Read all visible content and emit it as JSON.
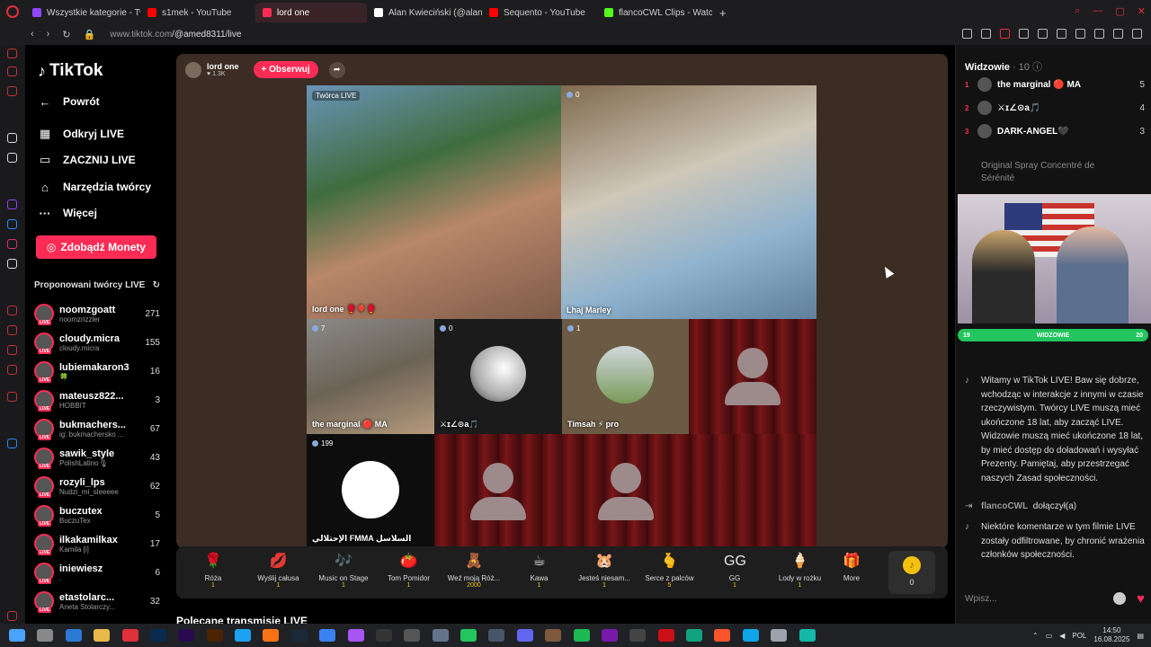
{
  "browser": {
    "tabs": [
      {
        "label": "Wszystkie kategorie - Tw",
        "color": "#9146ff",
        "active": false
      },
      {
        "label": "s1mek - YouTube",
        "color": "#ff0000",
        "active": false
      },
      {
        "label": "lord one",
        "color": "#fe2c55",
        "active": true
      },
      {
        "label": "Alan Kwieciński (@alanik",
        "color": "#ffffff",
        "active": false
      },
      {
        "label": "Sequento - YouTube",
        "color": "#ff0000",
        "active": false
      },
      {
        "label": "flancoCWL Clips - Watch",
        "color": "#53fc18",
        "active": false
      }
    ],
    "new_tab": "+",
    "url_domain": "www.tiktok.com",
    "url_path": "/@amed8311/live"
  },
  "tiktok": {
    "logo": "TikTok",
    "nav": [
      {
        "label": "Powrót",
        "icon": "arrow-left-icon",
        "glyph": "←"
      },
      {
        "label": "Odkryj LIVE",
        "icon": "calendar-icon",
        "glyph": "▦"
      },
      {
        "label": "ZACZNIJ LIVE",
        "icon": "camera-icon",
        "glyph": "▭"
      },
      {
        "label": "Narzędzia twórcy",
        "icon": "house-icon",
        "glyph": "⌂"
      },
      {
        "label": "Więcej",
        "icon": "ellipsis-icon",
        "glyph": "···"
      }
    ],
    "coins_button": "Zdobądź Monety",
    "suggested_title": "Proponowani twórcy LIVE",
    "creators": [
      {
        "name": "noomzgoatt",
        "sub": "noomzrizzler",
        "count": "271"
      },
      {
        "name": "cloudy.micra",
        "sub": "cloudy.micra",
        "count": "155"
      },
      {
        "name": "lubiemakaron3",
        "sub": "🍀",
        "count": "16"
      },
      {
        "name": "mateusz822...",
        "sub": "HOBBIT",
        "count": "3"
      },
      {
        "name": "bukmachers...",
        "sub": "ig: bukmachersko ...",
        "count": "67"
      },
      {
        "name": "sawik_style",
        "sub": "PolishLatino🎙",
        "count": "43"
      },
      {
        "name": "rozyli_lps",
        "sub": "Nudzi_mi_sleeeee",
        "count": "62"
      },
      {
        "name": "buczutex",
        "sub": "BuczuTex",
        "count": "5"
      },
      {
        "name": "ilkakamilkax",
        "sub": "Kamila [i]",
        "count": "17"
      },
      {
        "name": "iniewiesz",
        "sub": ".",
        "count": "6"
      },
      {
        "name": "etastolarc...",
        "sub": "Aneta Stolarczy...",
        "count": "32"
      }
    ]
  },
  "live": {
    "host": {
      "name": "lord one",
      "likes": "♥ 1.3K"
    },
    "follow_label": "+ Obserwuj",
    "cells": [
      {
        "label": "lord one 🥊🎈🥊",
        "tag": "Twórca LIVE"
      },
      {
        "label": "Lhaj Marley",
        "count": "0"
      },
      {
        "label": "the marginal 🔴 MA",
        "count": "7"
      },
      {
        "label": "⚔ɪ∠⊙a🎵",
        "count": "0"
      },
      {
        "label": "Timsah ⚡ pro",
        "count": "1"
      },
      {
        "label": "الإحتلالي FMMA السلاسل",
        "count": "199"
      }
    ],
    "gifts": [
      {
        "name": "Róża",
        "price": "1",
        "glyph": "🌹"
      },
      {
        "name": "Wyślij całusa",
        "price": "1",
        "glyph": "💋"
      },
      {
        "name": "Music on Stage",
        "price": "1",
        "glyph": "🎶"
      },
      {
        "name": "Tom Pomidor",
        "price": "1",
        "glyph": "🍅"
      },
      {
        "name": "Weź moją Róż...",
        "price": "2000",
        "glyph": "🧸"
      },
      {
        "name": "Kawa",
        "price": "1",
        "glyph": "☕"
      },
      {
        "name": "Jesteś niesam...",
        "price": "1",
        "glyph": "🐹"
      },
      {
        "name": "Serce z palców",
        "price": "5",
        "glyph": "🫰"
      },
      {
        "name": "GG",
        "price": "1",
        "glyph": "GG"
      },
      {
        "name": "Lody w rożku",
        "price": "1",
        "glyph": "🍦"
      },
      {
        "name": "More",
        "price": "",
        "glyph": "🎁"
      }
    ],
    "coin_balance": "0",
    "recommended": "Polecane transmisje LIVE"
  },
  "panel": {
    "title": "Widzowie",
    "count": "· 10",
    "top": [
      {
        "rank": "1",
        "name": "the marginal 🔴 MA",
        "score": "5"
      },
      {
        "rank": "2",
        "name": "⚔ɪ∠⊙a🎵",
        "score": "4"
      },
      {
        "rank": "3",
        "name": "DARK-ANGEL🖤",
        "score": "3"
      }
    ],
    "faded_text": "Original Spray Concentré de Sérénité",
    "battle_left": "19",
    "battle_mid": "WIDZOWIE",
    "battle_right": "20",
    "welcome": "Witamy w TikTok LIVE! Baw się dobrze, wchodząc w interakcje z innymi w czasie rzeczywistym. Twórcy LIVE muszą mieć ukończone 18 lat, aby zacząć LIVE. Widzowie muszą mieć ukończone 18 lat, by mieć dostęp do doładowań i wysyłać Prezenty. Pamiętaj, aby przestrzegać naszych Zasad społeczności.",
    "join_user": "flancoCWL",
    "join_text": "dołączył(a)",
    "filter_text": "Niektóre komentarze w tym filmie LIVE zostały odfiltrowane, by chronić wrażenia członków społeczności.",
    "chat_placeholder": "Wpisz..."
  },
  "taskbar": {
    "lang": "POL",
    "time": "14:50",
    "date": "16.08.2025"
  }
}
